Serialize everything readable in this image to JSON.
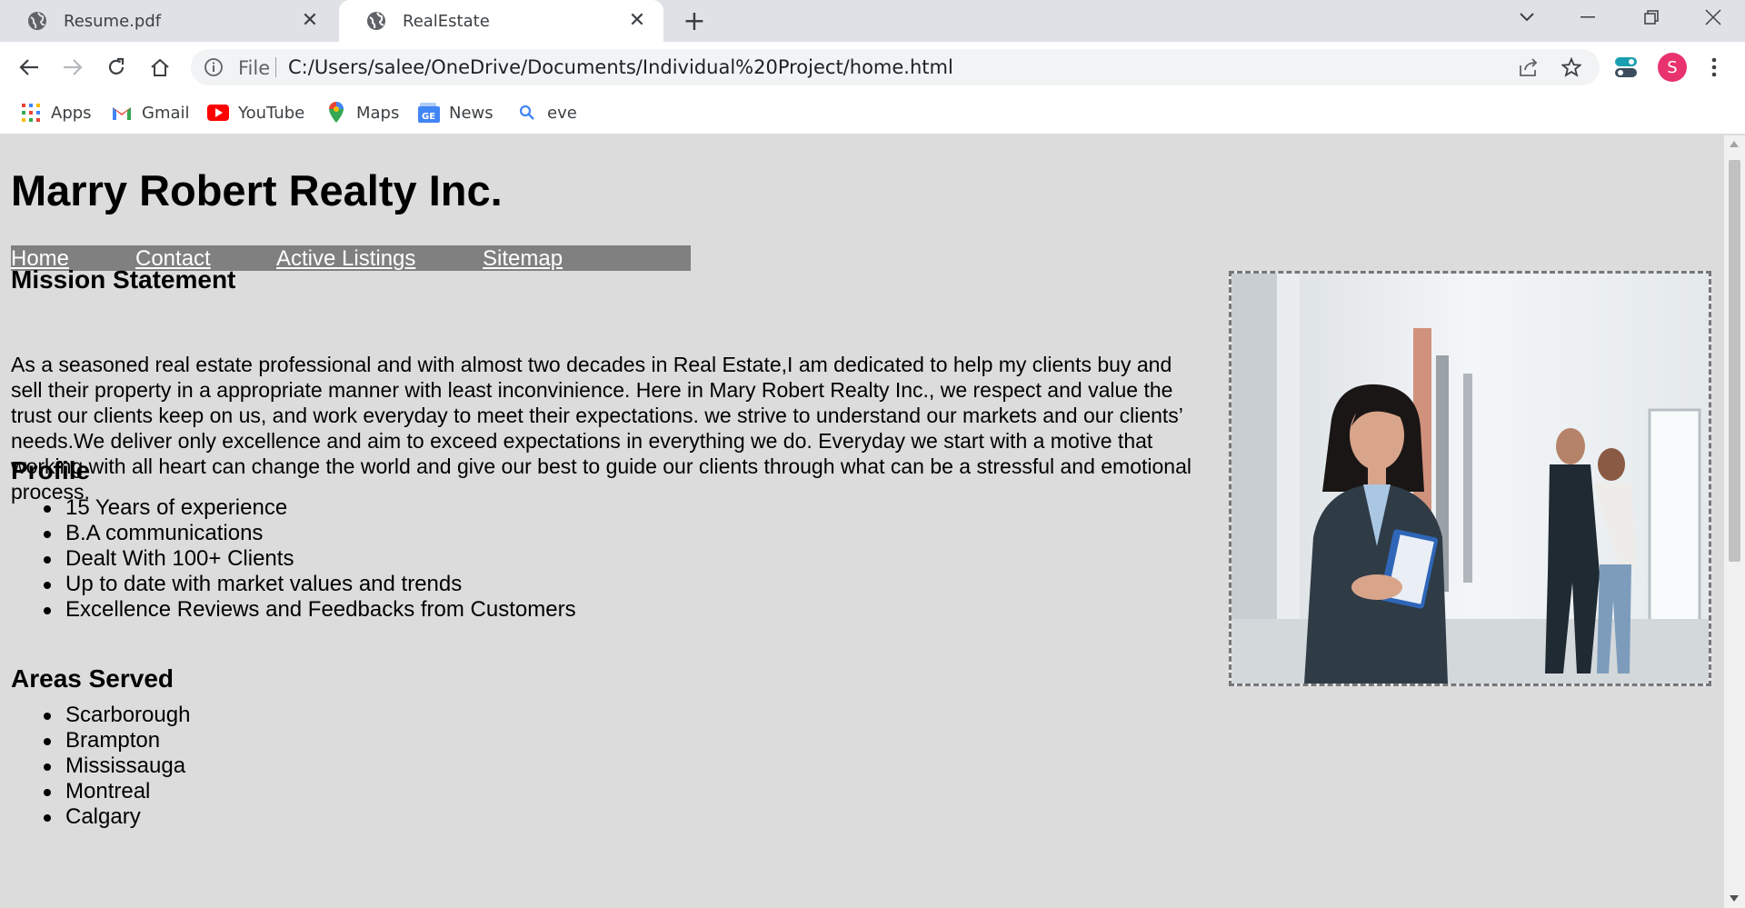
{
  "browser": {
    "tabs": [
      {
        "label": "Resume.pdf"
      },
      {
        "label": "RealEstate"
      }
    ],
    "address": {
      "scheme_label": "File",
      "url": "C:/Users/salee/OneDrive/Documents/Individual%20Project/home.html"
    },
    "profile_initial": "S",
    "bookmarks": [
      {
        "label": "Apps",
        "icon": "apps-grid-icon"
      },
      {
        "label": "Gmail",
        "icon": "gmail-icon"
      },
      {
        "label": "YouTube",
        "icon": "youtube-icon"
      },
      {
        "label": "Maps",
        "icon": "maps-pin-icon"
      },
      {
        "label": "News",
        "icon": "news-icon"
      },
      {
        "label": "eve",
        "icon": "search-icon"
      }
    ]
  },
  "page": {
    "title": "Marry Robert Realty Inc.",
    "nav": [
      {
        "label": "Home"
      },
      {
        "label": "Contact"
      },
      {
        "label": "Active Listings"
      },
      {
        "label": "Sitemap"
      }
    ],
    "mission": {
      "heading": "Mission Statement",
      "text": "As a seasoned real estate professional and with almost two decades in Real Estate,I am dedicated to help my clients buy and sell their property in a appropriate manner with least inconvinience. Here in Mary Robert Realty Inc., we respect and value the trust our clients keep on us, and work everyday to meet their expectations. we strive to understand our markets and our clients’ needs.We deliver only excellence and aim to exceed expectations in everything we do. Everyday we start with a motive that working with all heart can change the world and give our best to guide our clients through what can be a stressful and emotional process."
    },
    "profile": {
      "heading": "Profile",
      "items": [
        "15 Years of experience",
        "B.A communications",
        "Dealt With 100+ Clients",
        "Up to date with market values and trends",
        "Excellence Reviews and Feedbacks from Customers"
      ]
    },
    "areas": {
      "heading": "Areas Served",
      "items": [
        "Scarborough",
        "Brampton",
        "Mississauga",
        "Montreal",
        "Calgary"
      ]
    }
  }
}
